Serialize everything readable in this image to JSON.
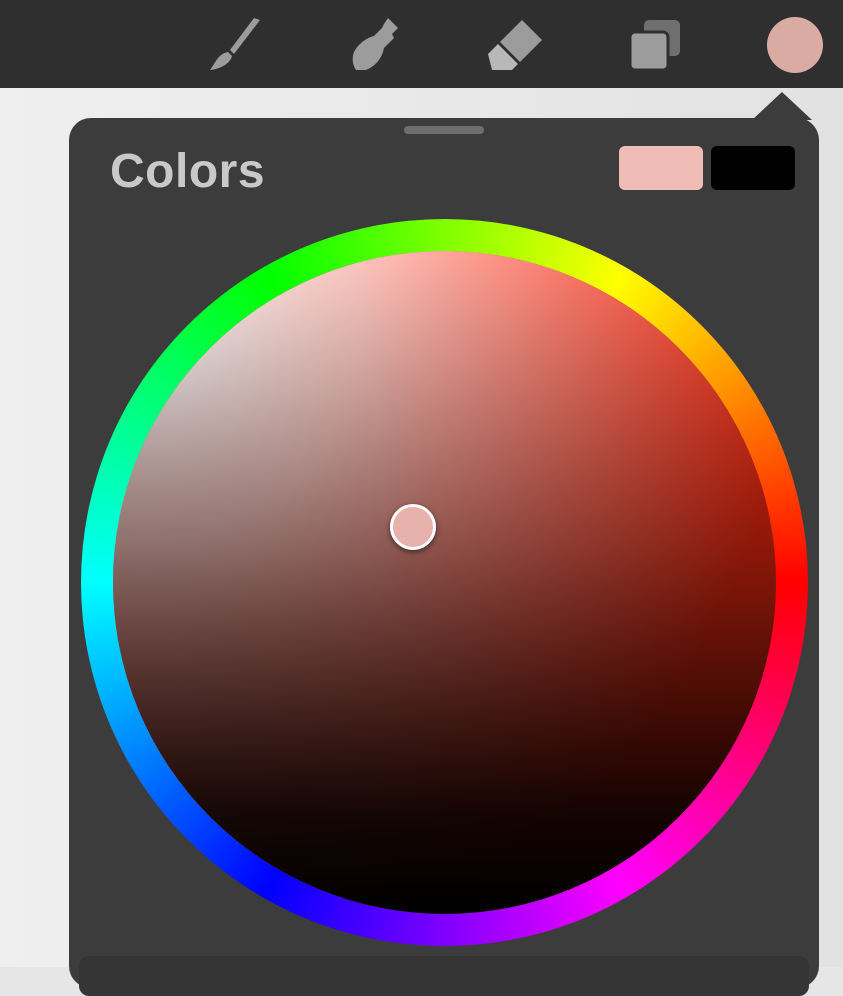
{
  "app": {
    "panel_title": "Colors"
  },
  "toolbar": {
    "tools": [
      {
        "name": "brush",
        "icon": "brush-icon"
      },
      {
        "name": "smudge",
        "icon": "smudge-icon"
      },
      {
        "name": "eraser",
        "icon": "eraser-icon"
      },
      {
        "name": "layers",
        "icon": "layers-icon"
      }
    ],
    "active_color": "#d9aba3",
    "icon_color": "#9c9c9c"
  },
  "colors": {
    "primary_swatch": "#efbcb6",
    "secondary_swatch": "#000000",
    "picker_color": "#e8b2ac",
    "panel_bg": "#3c3c3c"
  }
}
